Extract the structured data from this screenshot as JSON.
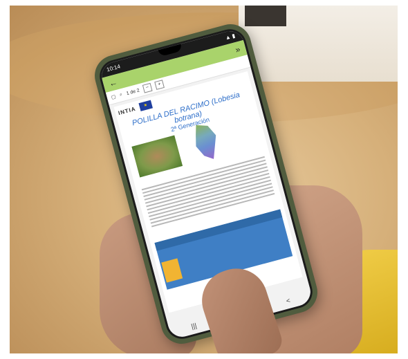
{
  "status": {
    "time": "10:14"
  },
  "appbar": {
    "back_icon": "arrow-left-icon",
    "forward_label": "»"
  },
  "toolbar": {
    "page_label": "1 de 2",
    "minus": "−",
    "plus": "+"
  },
  "doc": {
    "brand": "INTIA",
    "title": "POLILLA DEL RACIMO (Lobesia botrana)",
    "subtitle": "2ª Generación"
  },
  "nav": {
    "recent": "|||",
    "home": "○",
    "back": "<"
  }
}
